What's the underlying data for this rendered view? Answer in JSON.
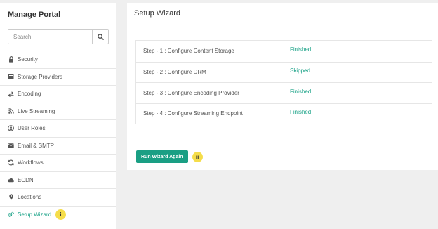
{
  "sidebar": {
    "title": "Manage Portal",
    "search_placeholder": "Search",
    "items": [
      {
        "label": "Security",
        "icon": "lock-icon"
      },
      {
        "label": "Storage Providers",
        "icon": "storage-icon"
      },
      {
        "label": "Encoding",
        "icon": "exchange-icon"
      },
      {
        "label": "Live Streaming",
        "icon": "rss-icon"
      },
      {
        "label": "User Roles",
        "icon": "user-circle-icon"
      },
      {
        "label": "Email & SMTP",
        "icon": "envelope-icon"
      },
      {
        "label": "Workflows",
        "icon": "refresh-icon"
      },
      {
        "label": "ECDN",
        "icon": "cloud-icon"
      },
      {
        "label": "Locations",
        "icon": "map-marker-icon"
      },
      {
        "label": "Setup Wizard",
        "icon": "cogs-icon",
        "badge": "i",
        "active": true
      }
    ]
  },
  "main": {
    "title": "Setup Wizard",
    "steps": [
      {
        "label": "Step - 1 : Configure Content Storage",
        "status": "Finished"
      },
      {
        "label": "Step - 2 : Configure DRM",
        "status": "Skipped"
      },
      {
        "label": "Step - 3 : Configure Encoding Provider",
        "status": "Finished"
      },
      {
        "label": "Step - 4 : Configure Streaming Endpoint",
        "status": "Finished"
      }
    ],
    "run_button": "Run Wizard Again",
    "run_badge": "ii"
  },
  "colors": {
    "accent": "#1aa287",
    "badge": "#f5dd4a"
  }
}
